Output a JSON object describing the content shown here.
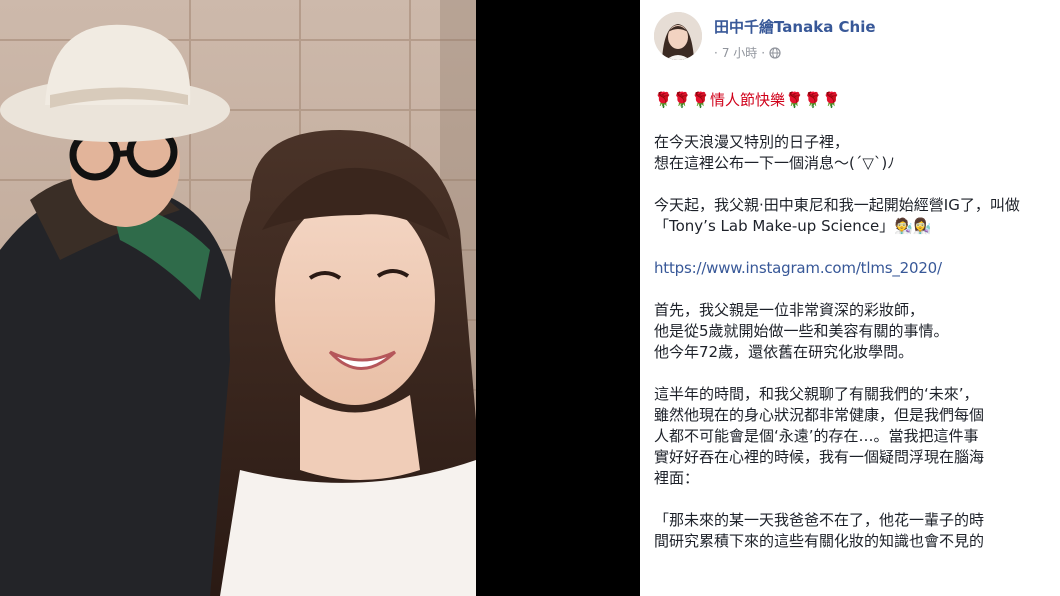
{
  "post": {
    "author": "田中千繪Tanaka Chie",
    "time": "7 小時",
    "meta_prefix": "·",
    "meta_sep": "·",
    "paragraphs": [
      "🌹🌹🌹情人節快樂🌹🌹🌹",
      "在今天浪漫又特別的日子裡，\n想在這裡公布一下一個消息～(´▽`)ﾉ",
      "今天起，我父親·田中東尼和我一起開始經營IG了，叫做「Tony’s Lab Make-up Science」🧑‍🔬👩‍🔬",
      "https://www.instagram.com/tlms_2020/",
      "首先，我父親是一位非常資深的彩妝師，\n他是從5歲就開始做一些和美容有關的事情。\n他今年72歲，還依舊在研究化妝學問。",
      "這半年的時間，和我父親聊了有關我們的‘未來’，\n雖然他現在的身心狀況都非常健康，但是我們每個\n人都不可能會是個‘永遠’的存在…。當我把這件事\n實好好吞在心裡的時候，我有一個疑問浮現在腦海\n裡面：",
      "「那未來的某一天我爸爸不在了，他花一輩子的時\n間研究累積下來的這些有關化妝的知識也會不見的"
    ]
  },
  "colors": {
    "author": "#385898",
    "link": "#385898",
    "meta": "#90949c",
    "text": "#1d2129",
    "background_right": "#ffffff",
    "background_left": "#000000"
  },
  "photo": {
    "subject": "selfie-father-and-daughter"
  }
}
